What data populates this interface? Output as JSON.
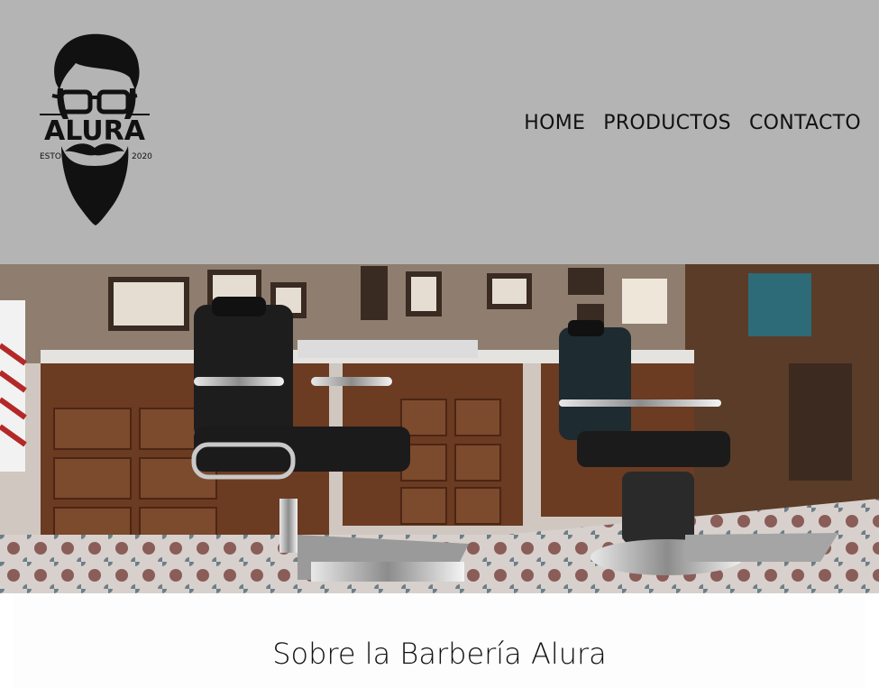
{
  "brand": {
    "name": "ALURA",
    "est": "ESTO",
    "year": "2020"
  },
  "nav": {
    "home": "HOME",
    "products": "PRODUCTOS",
    "contact": "CONTACTO"
  },
  "about": {
    "title": "Sobre la Barbería Alura"
  },
  "colors": {
    "header_bg": "#b4b4b4",
    "text": "#111111"
  }
}
